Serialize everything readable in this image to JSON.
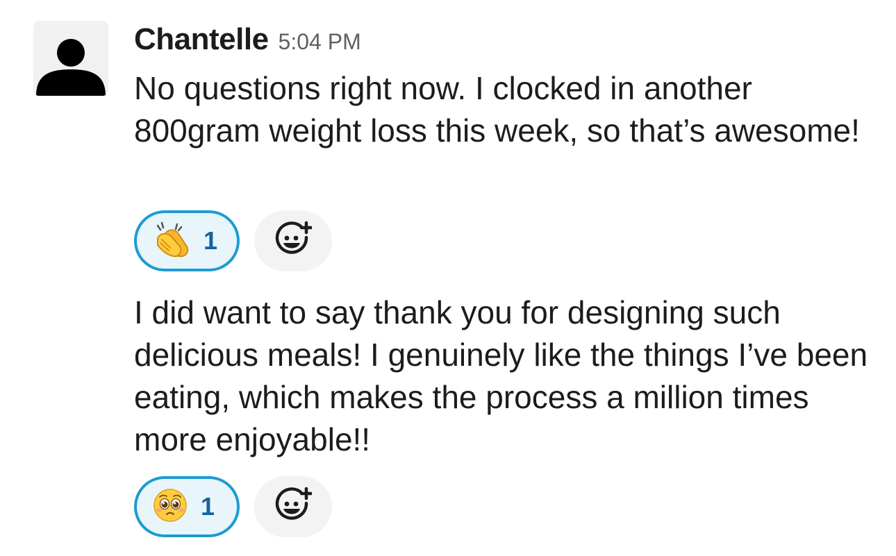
{
  "message": {
    "sender": "Chantelle",
    "timestamp": "5:04 PM",
    "avatar_icon": "default-user-avatar-icon",
    "posts": [
      {
        "text": "No questions right now. I clocked in another 800gram weight loss this week, so that’s awesome!",
        "reactions": [
          {
            "emoji_icon": "clapping-hands-emoji",
            "count": "1",
            "reacted_by_me": true
          }
        ],
        "add_reaction_icon": "add-reaction-icon"
      },
      {
        "text": "I did want to say thank you for designing such delicious meals! I genuinely like the things I’ve been eating, which makes the process a million times more enjoyable!!",
        "reactions": [
          {
            "emoji_icon": "pleading-face-emoji",
            "count": "1",
            "reacted_by_me": true
          }
        ],
        "add_reaction_icon": "add-reaction-icon"
      }
    ]
  },
  "colors": {
    "reaction_border": "#1d9bd1",
    "reaction_background": "#e8f5fa",
    "reaction_count": "#1264a3",
    "timestamp": "#616061",
    "text": "#1d1c1d"
  }
}
